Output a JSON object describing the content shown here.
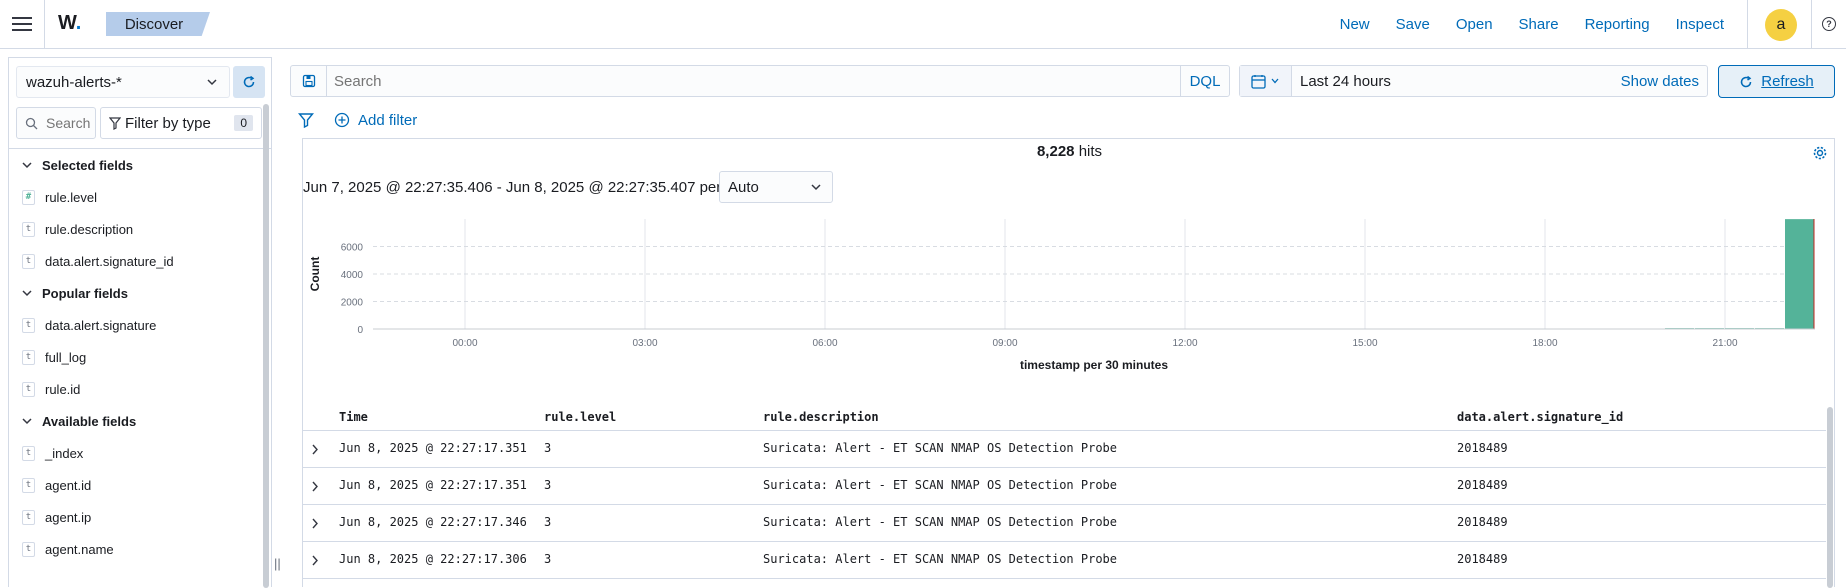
{
  "header": {
    "logo": "W",
    "logo_dot": ".",
    "breadcrumb": "Discover",
    "nav": [
      "New",
      "Save",
      "Open",
      "Share",
      "Reporting",
      "Inspect"
    ],
    "avatar_initial": "a",
    "help_glyph": "?"
  },
  "sidebar": {
    "index_pattern": "wazuh-alerts-*",
    "search_placeholder": "Search",
    "filter_by_type_label": "Filter by type",
    "filter_count": "0",
    "sections": [
      {
        "title": "Selected fields",
        "fields": [
          {
            "type": "#",
            "name": "rule.level"
          },
          {
            "type": "t",
            "name": "rule.description"
          },
          {
            "type": "t",
            "name": "data.alert.signature_id"
          }
        ]
      },
      {
        "title": "Popular fields",
        "fields": [
          {
            "type": "t",
            "name": "data.alert.signature"
          },
          {
            "type": "t",
            "name": "full_log"
          },
          {
            "type": "t",
            "name": "rule.id"
          }
        ]
      },
      {
        "title": "Available fields",
        "fields": [
          {
            "type": "t",
            "name": "_index"
          },
          {
            "type": "t",
            "name": "agent.id"
          },
          {
            "type": "t",
            "name": "agent.ip"
          },
          {
            "type": "t",
            "name": "agent.name"
          }
        ]
      }
    ]
  },
  "query": {
    "search_placeholder": "Search",
    "language": "DQL",
    "time_range": "Last 24 hours",
    "show_dates": "Show dates",
    "refresh": "Refresh",
    "add_filter": "Add filter"
  },
  "results": {
    "hits_count": "8,228",
    "hits_label": "hits",
    "range_text": "Jun 7, 2025 @ 22:27:35.406 - Jun 8, 2025 @ 22:27:35.407 per",
    "interval": "Auto"
  },
  "chart_data": {
    "type": "bar",
    "ylabel": "Count",
    "xlabel": "timestamp per 30 minutes",
    "yticks": [
      0,
      2000,
      4000,
      6000
    ],
    "ylim": [
      0,
      8000
    ],
    "xticks": [
      "00:00",
      "03:00",
      "06:00",
      "09:00",
      "12:00",
      "15:00",
      "18:00",
      "21:00"
    ],
    "x": [
      "20:00",
      "20:30",
      "21:00",
      "21:30",
      "22:00"
    ],
    "values": [
      60,
      60,
      60,
      60,
      7990
    ],
    "color": "#54b399",
    "grid": true
  },
  "table": {
    "columns": [
      "Time",
      "rule.level",
      "rule.description",
      "data.alert.signature_id"
    ],
    "rows": [
      [
        "Jun 8, 2025 @ 22:27:17.351",
        "3",
        "Suricata: Alert - ET SCAN NMAP OS Detection Probe",
        "2018489"
      ],
      [
        "Jun 8, 2025 @ 22:27:17.351",
        "3",
        "Suricata: Alert - ET SCAN NMAP OS Detection Probe",
        "2018489"
      ],
      [
        "Jun 8, 2025 @ 22:27:17.346",
        "3",
        "Suricata: Alert - ET SCAN NMAP OS Detection Probe",
        "2018489"
      ],
      [
        "Jun 8, 2025 @ 22:27:17.306",
        "3",
        "Suricata: Alert - ET SCAN NMAP OS Detection Probe",
        "2018489"
      ]
    ]
  }
}
